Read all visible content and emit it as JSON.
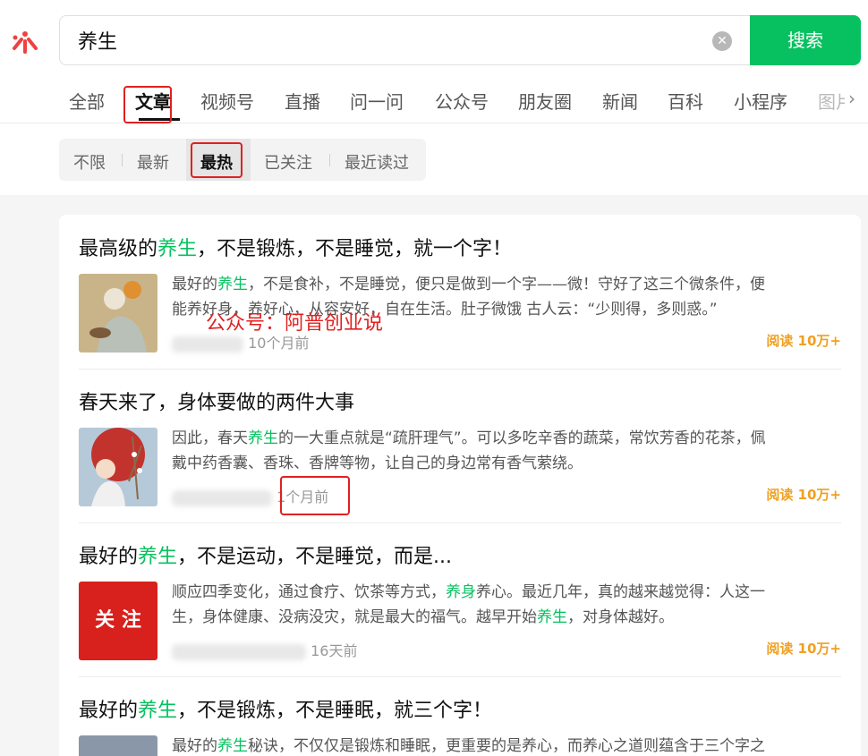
{
  "search": {
    "value": "养生",
    "button_label": "搜索"
  },
  "tabs": [
    "全部",
    "文章",
    "视频号",
    "直播",
    "问一问",
    "公众号",
    "朋友圈",
    "新闻",
    "百科",
    "小程序",
    "图片"
  ],
  "filters": [
    "不限",
    "最新",
    "最热",
    "已关注",
    "最近读过"
  ],
  "watermark": "公众号：阿普创业说",
  "articles": [
    {
      "title_pre": "最高级的",
      "title_hl": "养生",
      "title_post": "，不是锻炼，不是睡觉，就一个字！",
      "desc_1a": "最好的",
      "desc_1hl": "养生",
      "desc_1b": "，不是食补，不是睡觉，便只是做到一个字——微！守好了这三个微条件，便",
      "desc_2": "能养好身，养好心，从容安好，自在生活。肚子微饿 古人云：“少则得，多则惑。”",
      "time": "10个月前",
      "reads": "阅读 10万+"
    },
    {
      "title": "春天来了，身体要做的两件大事",
      "desc_1a": "因此，春天",
      "desc_1hl": "养生",
      "desc_1b": "的一大重点就是“疏肝理气”。可以多吃辛香的蔬菜，常饮芳香的花茶，佩",
      "desc_2": "戴中药香囊、香珠、香牌等物，让自己的身边常有香气萦绕。",
      "time": "1个月前",
      "reads": "阅读 10万+"
    },
    {
      "title_pre": "最好的",
      "title_hl": "养生",
      "title_post": "，不是运动，不是睡觉，而是...",
      "desc_1a": "顺应四季变化，通过食疗、饮茶等方式，",
      "desc_1hl": "养身",
      "desc_1b": "养心。最近几年，真的越来越觉得：人这一",
      "desc_2a": "生，身体健康、没病没灾，就是最大的福气。越早开始",
      "desc_2hl": "养生",
      "desc_2b": "，对身体越好。",
      "thumb_text": "关 注",
      "time": "16天前",
      "reads": "阅读 10万+"
    },
    {
      "title_pre": "最好的",
      "title_hl": "养生",
      "title_post": "，不是锻炼，不是睡眠，就三个字！",
      "desc_1a": "最好的",
      "desc_1hl": "养生",
      "desc_1b": "秘诀，不仅仅是锻炼和睡眠，更重要的是养心，而养心之道则蕴含于三个字之"
    }
  ]
}
